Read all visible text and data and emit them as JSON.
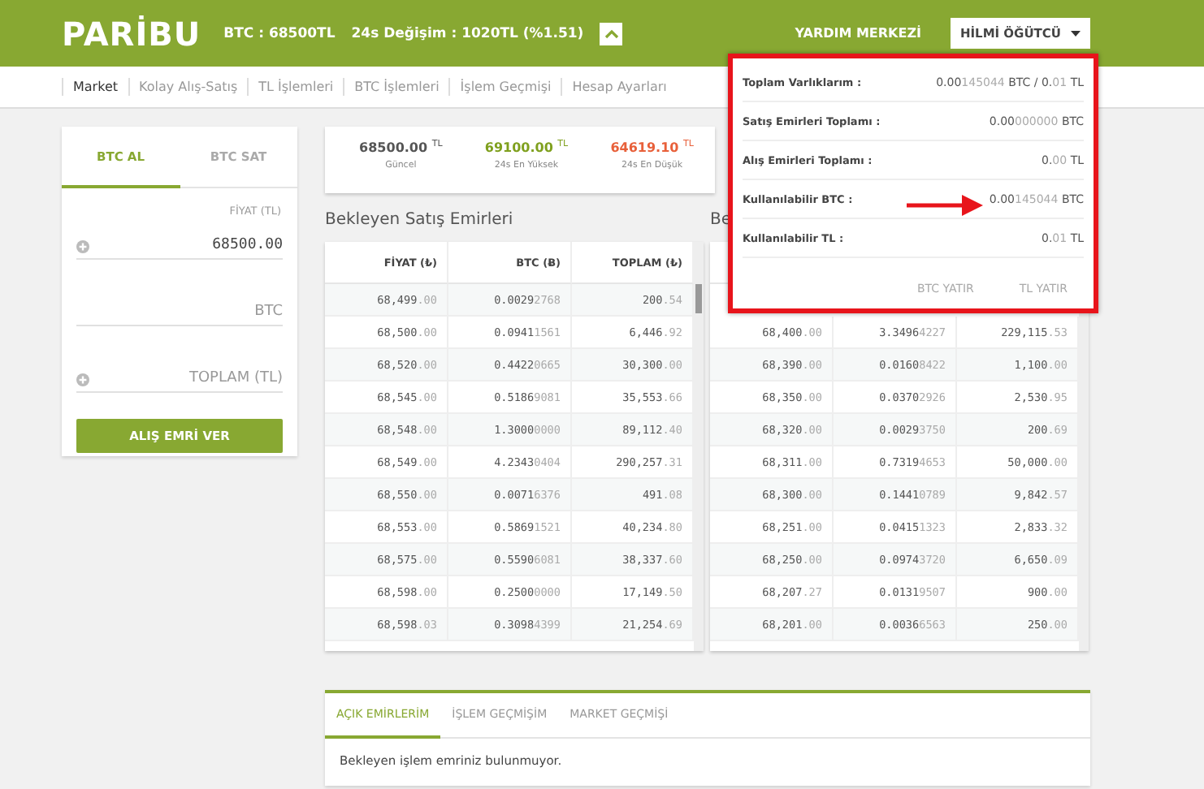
{
  "header": {
    "logo": "PARİBU",
    "price": "BTC : 68500TL",
    "change": "24s Değişim : 1020TL (%1.51)",
    "help": "YARDIM MERKEZİ",
    "user": "HİLMİ ÖĞÜTCÜ"
  },
  "nav": [
    {
      "label": "Market",
      "selected": true
    },
    {
      "label": "Kolay Alış-Satış",
      "selected": false
    },
    {
      "label": "TL İşlemleri",
      "selected": false
    },
    {
      "label": "BTC İşlemleri",
      "selected": false
    },
    {
      "label": "İşlem Geçmişi",
      "selected": false
    },
    {
      "label": "Hesap Ayarları",
      "selected": false
    }
  ],
  "order_form": {
    "tabs": [
      {
        "label": "BTC AL",
        "selected": true
      },
      {
        "label": "BTC SAT",
        "selected": false
      }
    ],
    "fields": [
      {
        "label": "FİYAT (TL)",
        "value": "68500.00",
        "stepper": true
      },
      {
        "placeholder": "BTC",
        "stepper": false
      },
      {
        "placeholder": "TOPLAM (TL)",
        "stepper": true
      }
    ],
    "submit": "ALIŞ EMRİ VER"
  },
  "stats": [
    {
      "value": "68500.00",
      "unit": "TL",
      "label": "Güncel",
      "color": "#555555"
    },
    {
      "value": "69100.00",
      "unit": "TL",
      "label": "24s En Yüksek",
      "color": "#7fa01e"
    },
    {
      "value": "64619.10",
      "unit": "TL",
      "label": "24s En Düşük",
      "color": "#e8603a"
    }
  ],
  "sell_orders": {
    "title": "Bekleyen Satış Emirleri",
    "columns": [
      "FİYAT (₺)",
      "BTC (Ƀ)",
      "TOPLAM (₺)"
    ],
    "rows": [
      [
        [
          "68,499",
          ".00"
        ],
        [
          "0.0029",
          "2768"
        ],
        [
          "200",
          ".54"
        ]
      ],
      [
        [
          "68,500",
          ".00"
        ],
        [
          "0.0941",
          "1561"
        ],
        [
          "6,446",
          ".92"
        ]
      ],
      [
        [
          "68,520",
          ".00"
        ],
        [
          "0.4422",
          "0665"
        ],
        [
          "30,300",
          ".00"
        ]
      ],
      [
        [
          "68,545",
          ".00"
        ],
        [
          "0.5186",
          "9081"
        ],
        [
          "35,553",
          ".66"
        ]
      ],
      [
        [
          "68,548",
          ".00"
        ],
        [
          "1.3000",
          "0000"
        ],
        [
          "89,112",
          ".40"
        ]
      ],
      [
        [
          "68,549",
          ".00"
        ],
        [
          "4.2343",
          "0404"
        ],
        [
          "290,257",
          ".31"
        ]
      ],
      [
        [
          "68,550",
          ".00"
        ],
        [
          "0.0071",
          "6376"
        ],
        [
          "491",
          ".08"
        ]
      ],
      [
        [
          "68,553",
          ".00"
        ],
        [
          "0.5869",
          "1521"
        ],
        [
          "40,234",
          ".80"
        ]
      ],
      [
        [
          "68,575",
          ".00"
        ],
        [
          "0.5590",
          "6081"
        ],
        [
          "38,337",
          ".60"
        ]
      ],
      [
        [
          "68,598",
          ".00"
        ],
        [
          "0.2500",
          "0000"
        ],
        [
          "17,149",
          ".50"
        ]
      ],
      [
        [
          "68,598",
          ".03"
        ],
        [
          "0.3098",
          "4399"
        ],
        [
          "21,254",
          ".69"
        ]
      ]
    ]
  },
  "buy_orders": {
    "title": "Be",
    "rows": [
      [
        [
          "68,400",
          ".00"
        ],
        [
          "3.3496",
          "4227"
        ],
        [
          "229,115",
          ".53"
        ]
      ],
      [
        [
          "68,390",
          ".00"
        ],
        [
          "0.0160",
          "8422"
        ],
        [
          "1,100",
          ".00"
        ]
      ],
      [
        [
          "68,350",
          ".00"
        ],
        [
          "0.0370",
          "2926"
        ],
        [
          "2,530",
          ".95"
        ]
      ],
      [
        [
          "68,320",
          ".00"
        ],
        [
          "0.0029",
          "3750"
        ],
        [
          "200",
          ".69"
        ]
      ],
      [
        [
          "68,311",
          ".00"
        ],
        [
          "0.7319",
          "4653"
        ],
        [
          "50,000",
          ".00"
        ]
      ],
      [
        [
          "68,300",
          ".00"
        ],
        [
          "0.1441",
          "0789"
        ],
        [
          "9,842",
          ".57"
        ]
      ],
      [
        [
          "68,251",
          ".00"
        ],
        [
          "0.0415",
          "1323"
        ],
        [
          "2,833",
          ".32"
        ]
      ],
      [
        [
          "68,250",
          ".00"
        ],
        [
          "0.0974",
          "3720"
        ],
        [
          "6,650",
          ".09"
        ]
      ],
      [
        [
          "68,207",
          ".27"
        ],
        [
          "0.0131",
          "9507"
        ],
        [
          "900",
          ".00"
        ]
      ],
      [
        [
          "68,201",
          ".00"
        ],
        [
          "0.0036",
          "6563"
        ],
        [
          "250",
          ".00"
        ]
      ]
    ]
  },
  "balance_popup": {
    "rows": [
      {
        "label": "Toplam Varlıklarım :",
        "value": [
          {
            "text": "0.00",
            "dim": false
          },
          {
            "text": "145044",
            "dim": true
          },
          {
            "text": " BTC / 0.",
            "dim": false
          },
          {
            "text": "01",
            "dim": true
          },
          {
            "text": " TL",
            "dim": false
          }
        ],
        "highlighted": false
      },
      {
        "label": "Satış Emirleri Toplamı :",
        "value": [
          {
            "text": "0.00",
            "dim": false
          },
          {
            "text": "000000",
            "dim": true
          },
          {
            "text": " BTC",
            "dim": false
          }
        ],
        "highlighted": false
      },
      {
        "label": "Alış Emirleri Toplamı :",
        "value": [
          {
            "text": "0.",
            "dim": false
          },
          {
            "text": "00",
            "dim": true
          },
          {
            "text": " TL",
            "dim": false
          }
        ],
        "highlighted": false
      },
      {
        "label": "Kullanılabilir BTC :",
        "value": [
          {
            "text": "0.00",
            "dim": false
          },
          {
            "text": "145044",
            "dim": true
          },
          {
            "text": " BTC",
            "dim": false
          }
        ],
        "highlighted": true
      },
      {
        "label": "Kullanılabilir TL :",
        "value": [
          {
            "text": "0.",
            "dim": false
          },
          {
            "text": "01",
            "dim": true
          },
          {
            "text": " TL",
            "dim": false
          }
        ],
        "highlighted": false
      }
    ],
    "actions": [
      "BTC YATIR",
      "TL YATIR"
    ]
  },
  "bottom_panel": {
    "tabs": [
      {
        "label": "AÇIK EMİRLERİM",
        "selected": true
      },
      {
        "label": "İŞLEM GEÇMİŞİM",
        "selected": false
      },
      {
        "label": "MARKET GEÇMİŞİ",
        "selected": false
      }
    ],
    "message": "Bekleyen işlem emriniz bulunmuyor."
  }
}
